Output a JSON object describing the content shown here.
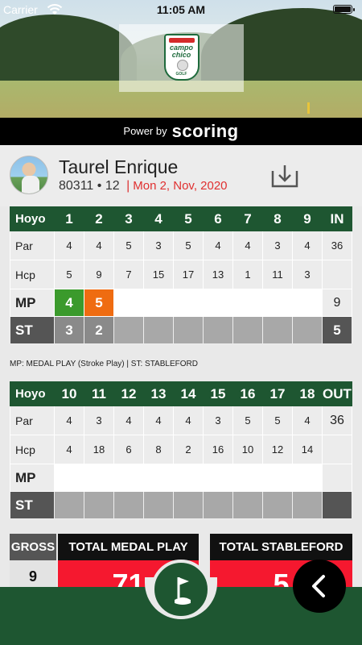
{
  "status": {
    "carrier": "Carrier",
    "time": "11:05 AM"
  },
  "brand": {
    "powered_by": "Power by",
    "name": "SCORING",
    "logo_line1": "campo",
    "logo_line2": "chico",
    "logo_line3": "GOLF"
  },
  "player": {
    "name": "Taurel Enrique",
    "id": "80311",
    "handicap": "12",
    "bullet": "•",
    "separator": "|",
    "date": "Mon 2, Nov, 2020"
  },
  "front": {
    "header": [
      "Hoyo",
      "1",
      "2",
      "3",
      "4",
      "5",
      "6",
      "7",
      "8",
      "9",
      "IN"
    ],
    "par": [
      "Par",
      "4",
      "4",
      "5",
      "3",
      "5",
      "4",
      "4",
      "3",
      "4",
      "36"
    ],
    "hcp": [
      "Hcp",
      "5",
      "9",
      "7",
      "15",
      "17",
      "13",
      "1",
      "11",
      "3",
      ""
    ],
    "mp": [
      "MP",
      "4",
      "5",
      "",
      "",
      "",
      "",
      "",
      "",
      "",
      "9"
    ],
    "st": [
      "ST",
      "3",
      "2",
      "",
      "",
      "",
      "",
      "",
      "",
      "",
      "5"
    ]
  },
  "legend": "MP: MEDAL PLAY (Stroke Play) | ST: STABLEFORD",
  "back": {
    "header": [
      "Hoyo",
      "10",
      "11",
      "12",
      "13",
      "14",
      "15",
      "16",
      "17",
      "18",
      "OUT"
    ],
    "par": [
      "Par",
      "4",
      "3",
      "4",
      "4",
      "4",
      "3",
      "5",
      "5",
      "4",
      "36"
    ],
    "hcp": [
      "Hcp",
      "4",
      "18",
      "6",
      "8",
      "2",
      "16",
      "10",
      "12",
      "14",
      ""
    ],
    "mp": [
      "MP",
      "",
      "",
      "",
      "",
      "",
      "",
      "",
      "",
      "",
      ""
    ],
    "st": [
      "ST",
      "",
      "",
      "",
      "",
      "",
      "",
      "",
      "",
      "",
      ""
    ]
  },
  "totals": {
    "gross_label": "GROSS",
    "gross_value": "9",
    "medal_label": "TOTAL MEDAL PLAY",
    "medal_value": "71",
    "stableford_label": "TOTAL STABLEFORD",
    "stableford_value": "5"
  },
  "icons": {
    "download": "download-icon",
    "golf_flag": "golf-flag-icon",
    "back": "chevron-left-icon"
  },
  "colors": {
    "primary_green": "#1e5631",
    "birdie_green": "#3b9a2c",
    "bogey_orange": "#ef6c11",
    "total_red": "#f5182f",
    "date_red": "#e03030"
  }
}
